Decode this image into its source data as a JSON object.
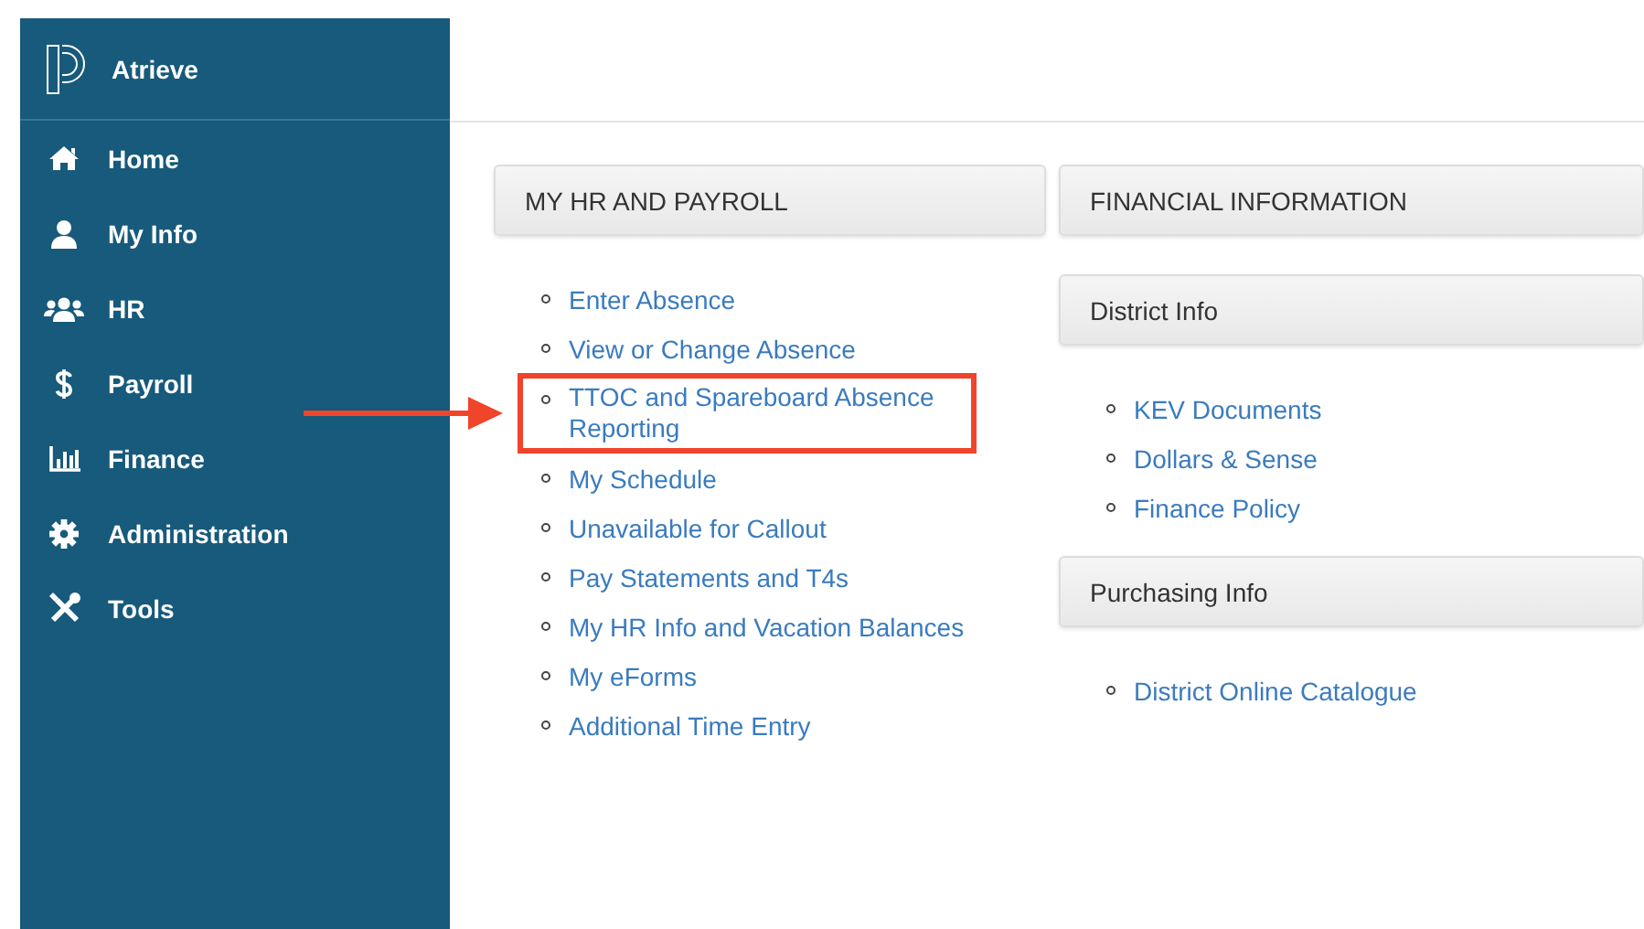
{
  "sidebar": {
    "brand": "Atrieve",
    "items": [
      {
        "label": "Home"
      },
      {
        "label": "My Info"
      },
      {
        "label": "HR"
      },
      {
        "label": "Payroll"
      },
      {
        "label": "Finance"
      },
      {
        "label": "Administration"
      },
      {
        "label": "Tools"
      }
    ]
  },
  "columns": [
    {
      "heading": "MY HR AND PAYROLL",
      "groups": [
        {
          "links": [
            {
              "label": "Enter Absence",
              "highlighted": false
            },
            {
              "label": "View or Change Absence",
              "highlighted": false
            },
            {
              "label": "TTOC and Spareboard Absence Reporting",
              "highlighted": true
            },
            {
              "label": "My Schedule",
              "highlighted": false
            },
            {
              "label": "Unavailable for Callout",
              "highlighted": false
            },
            {
              "label": "Pay Statements and T4s",
              "highlighted": false
            },
            {
              "label": "My HR Info and Vacation Balances",
              "highlighted": false
            },
            {
              "label": "My eForms",
              "highlighted": false
            },
            {
              "label": "Additional Time Entry",
              "highlighted": false
            }
          ]
        }
      ]
    },
    {
      "heading": "FINANCIAL INFORMATION",
      "groups": [
        {
          "title": "District Info",
          "links": [
            {
              "label": "KEV Documents",
              "highlighted": false
            },
            {
              "label": "Dollars & Sense",
              "highlighted": false
            },
            {
              "label": "Finance Policy",
              "highlighted": false
            }
          ]
        },
        {
          "title": "Purchasing Info",
          "links": [
            {
              "label": "District Online Catalogue",
              "highlighted": false
            }
          ]
        }
      ]
    }
  ]
}
